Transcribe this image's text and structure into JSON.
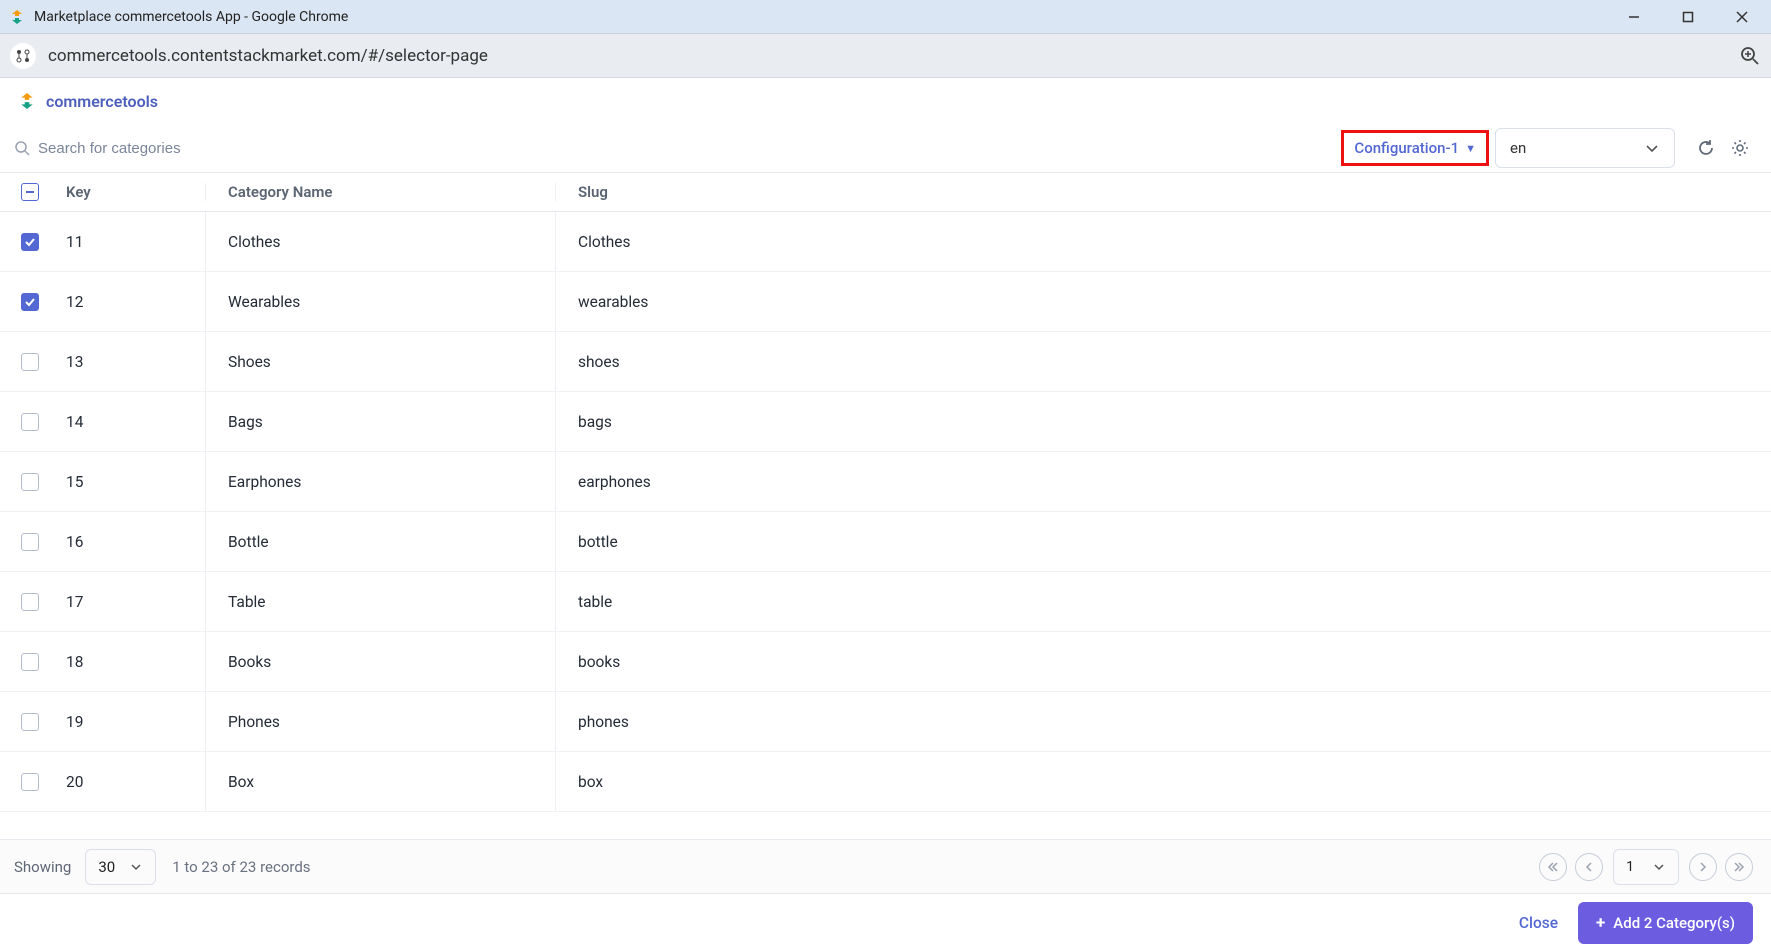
{
  "window": {
    "title": "Marketplace commercetools App - Google Chrome",
    "url": "commercetools.contentstackmarket.com/#/selector-page"
  },
  "app": {
    "name": "commercetools"
  },
  "toolbar": {
    "search_placeholder": "Search for categories",
    "config_label": "Configuration-1",
    "locale_label": "en"
  },
  "table": {
    "headers": {
      "key": "Key",
      "name": "Category Name",
      "slug": "Slug"
    },
    "rows": [
      {
        "checked": true,
        "key": "11",
        "name": "Clothes",
        "slug": "Clothes"
      },
      {
        "checked": true,
        "key": "12",
        "name": "Wearables",
        "slug": "wearables"
      },
      {
        "checked": false,
        "key": "13",
        "name": "Shoes",
        "slug": "shoes"
      },
      {
        "checked": false,
        "key": "14",
        "name": "Bags",
        "slug": "bags"
      },
      {
        "checked": false,
        "key": "15",
        "name": "Earphones",
        "slug": "earphones"
      },
      {
        "checked": false,
        "key": "16",
        "name": "Bottle",
        "slug": "bottle"
      },
      {
        "checked": false,
        "key": "17",
        "name": "Table",
        "slug": "table"
      },
      {
        "checked": false,
        "key": "18",
        "name": "Books",
        "slug": "books"
      },
      {
        "checked": false,
        "key": "19",
        "name": "Phones",
        "slug": "phones"
      },
      {
        "checked": false,
        "key": "20",
        "name": "Box",
        "slug": "box"
      }
    ]
  },
  "footer": {
    "showing_label": "Showing",
    "page_size": "30",
    "records_text": "1 to 23 of 23 records",
    "current_page": "1"
  },
  "actions": {
    "close_label": "Close",
    "add_label": "Add 2 Category(s)"
  }
}
